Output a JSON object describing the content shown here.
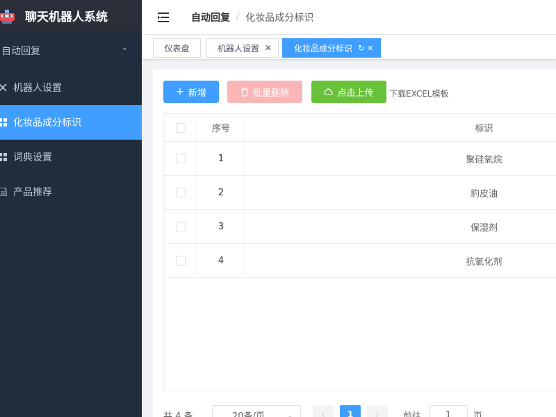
{
  "app": {
    "title": "聊天机器人系统"
  },
  "sidebar": {
    "parent": {
      "label": "自动回复",
      "chevron": "chevron-up-icon"
    },
    "items": [
      {
        "label": "机器人设置",
        "icon": "tools-icon",
        "active": false
      },
      {
        "label": "化妆品成分标识",
        "icon": "grid-icon",
        "active": true
      },
      {
        "label": "词典设置",
        "icon": "grid-icon",
        "active": false
      },
      {
        "label": "产品推荐",
        "icon": "document-icon",
        "active": false
      }
    ]
  },
  "header": {
    "breadcrumb": {
      "home": "自动回复",
      "separator": "/",
      "current": "化妆品成分标识"
    }
  },
  "tags": [
    {
      "label": "仪表盘"
    },
    {
      "label": "机器人设置"
    },
    {
      "label": "化妆品成分标识"
    }
  ],
  "toolbar": {
    "add_label": "新增",
    "batch_delete_label": "批量删除",
    "upload_label": "点击上传",
    "download_template_label": "下载EXCEL模板"
  },
  "table": {
    "columns": {
      "index": "序号",
      "name": "标识"
    },
    "rows": [
      {
        "index": "1",
        "name": "聚硅氧烷"
      },
      {
        "index": "2",
        "name": "豹皮油"
      },
      {
        "index": "3",
        "name": "保湿剂"
      },
      {
        "index": "4",
        "name": "抗氧化剂"
      }
    ]
  },
  "pagination": {
    "total_text": "共 4 条",
    "page_size_text": "20条/页",
    "current_page": "1",
    "goto_label": "前往",
    "goto_value": "1",
    "page_suffix": "页"
  },
  "colors": {
    "primary": "#409eff",
    "danger_disabled": "#fab6b6",
    "success": "#67c23a",
    "sidebar_bg": "#1f2d3d"
  }
}
